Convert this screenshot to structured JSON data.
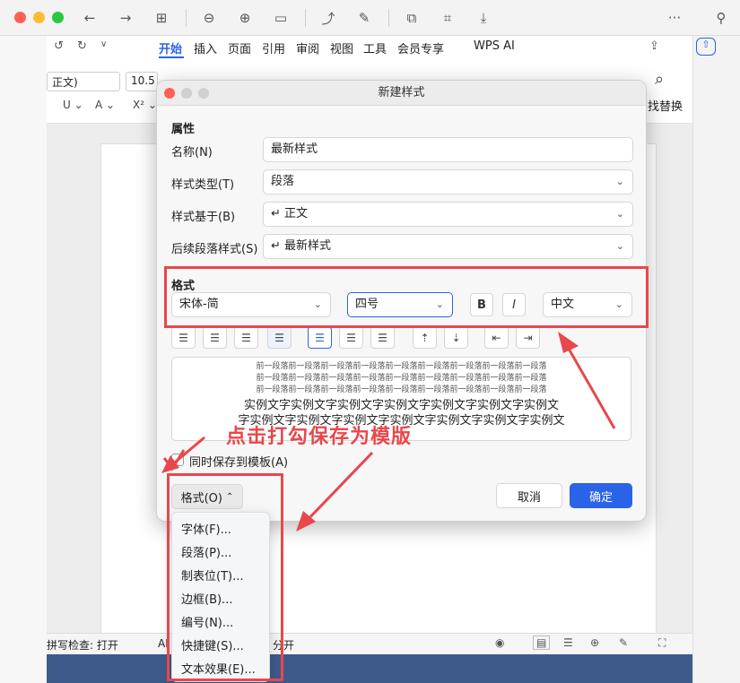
{
  "toolbar": {
    "menu_icon": "more-icon"
  },
  "ribbon": {
    "tabs": [
      "开始",
      "插入",
      "页面",
      "引用",
      "审阅",
      "视图",
      "工具",
      "会员专享",
      "WPS AI"
    ],
    "style_box": "正文)",
    "font_size": "10.5",
    "find_replace": "找替换"
  },
  "status": {
    "spell": "拼写检查: 打开",
    "ai": "AI",
    "split": "分开"
  },
  "dialog": {
    "title": "新建样式",
    "properties_section": "属性",
    "name_label": "名称(N)",
    "name_value": "最新样式",
    "style_type_label": "样式类型(T)",
    "style_type_value": "段落",
    "based_on_label": "样式基于(B)",
    "based_on_value": "正文",
    "next_label": "后续段落样式(S)",
    "next_value": "最新样式",
    "format_section": "格式",
    "font_value": "宋体-简",
    "size_value": "四号",
    "bold_label": "B",
    "italic_label": "I",
    "lang_value": "中文",
    "preview_prev_lines": [
      "前一段落前一段落前一段落前一段落前一段落前一段落前一段落前一段落前一段落",
      "前一段落前一段落前一段落前一段落前一段落前一段落前一段落前一段落前一段落",
      "前一段落前一段落前一段落前一段落前一段落前一段落前一段落前一段落前一段落"
    ],
    "preview_sample_lines": [
      "实例文字实例文字实例文字实例文字实例文字实例文字实例文",
      "字实例文字实例文字实例文字实例文字实例文字实例文字实例文"
    ],
    "save_template_label": "同时保存到模板(A)",
    "format_button": "格式(O)",
    "cancel_button": "取消",
    "ok_button": "确定"
  },
  "format_menu": {
    "items": [
      "字体(F)...",
      "段落(P)...",
      "制表位(T)...",
      "边框(B)...",
      "编号(N)...",
      "快捷键(S)...",
      "文本效果(E)..."
    ]
  },
  "annotation": {
    "text": "点击打勾保存为模版",
    "color": "#e8474b"
  }
}
